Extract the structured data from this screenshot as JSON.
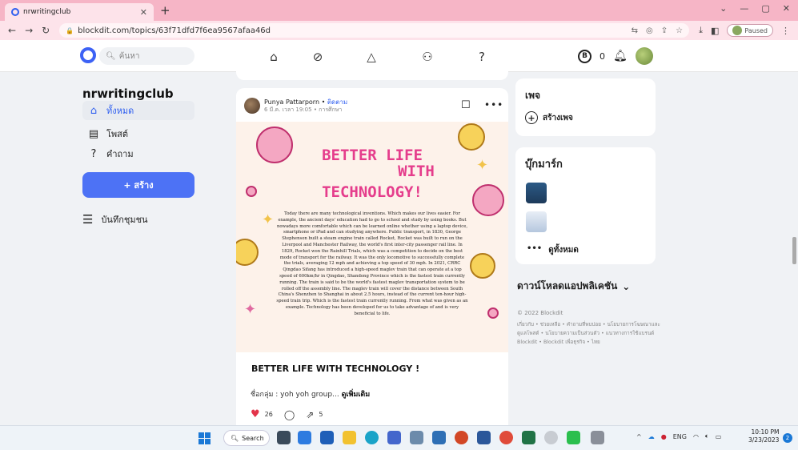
{
  "browser": {
    "tab_title": "nrwritingclub",
    "url": "blockdit.com/topics/63f71dfd7f6ea9567afaa46d",
    "paused_label": "Paused"
  },
  "header": {
    "search_placeholder": "ค้นหา",
    "coin_count": "0"
  },
  "sidebar": {
    "club_name": "nrwritingclub",
    "items": [
      {
        "label": "ทั้งหมด"
      },
      {
        "label": "โพสต์"
      },
      {
        "label": "คำถาม"
      }
    ],
    "create_label": "+ สร้าง",
    "notes_label": "บันทึกชุมชน"
  },
  "post": {
    "author": "Punya Pattarporn",
    "follow_label": "ติดตาม",
    "meta": "6 มี.ค. เวลา 19:05 • การศึกษา",
    "image_title_lines": [
      "BETTER LIFE",
      "WITH",
      "TECHNOLOGY!"
    ],
    "image_body": "Today there are many technological inventions. Which makes our lives easier. For example, the ancient days' education had to go to school and study by using books. But nowadays more comfortable which can be learned online whether using a laptop device, smartphone or iPad and can studying anywhere. Public transport, in 1830, George Stephenson built a steam engine train called Rocket, Rocket was built to run on the Liverpool and Manchester Railway, the world's first inter-city passenger rail line. In 1829, Rocket won the Rainhill Trials, which was a competition to decide on the best mode of transport for the railway. It was the only locomotive to successfully complete the trials, averaging 12 mph and achieving a top speed of 30 mph. In 2021, CRRC Qingdao Sifang has introduced a high-speed maglev train that can operate at a top speed of 600km/hr in Qingdao, Shandong Province which is the fastest train currently running. The train is said to be the world's fastest maglev transportation system to be rolled off the assembly line. The maglev train will cover the distance between South China's Shenzhen to Shanghai in about 2.5 hours, instead of the current ten-hour high-speed train trip. Which is the fastest train currently running. From what was given as an example. Technology has been developed for us to take advantage of and is very beneficial to life.",
    "title": "BETTER LIFE WITH TECHNOLOGY !",
    "group_prefix": "ชื่อกลุ่ม : yoh yoh group...",
    "see_more": "ดูเพิ่มเติม",
    "likes": "26",
    "shares": "5"
  },
  "right": {
    "page_title": "เพจ",
    "create_page": "สร้างเพจ",
    "bookmark_title": "บุ๊กมาร์ก",
    "see_all": "ดูทั้งหมด",
    "download_app": "ดาวน์โหลดแอปพลิเคชัน",
    "copyright": "© 2022 Blockdit",
    "footer_links": "เกี่ยวกับ • ช่วยเหลือ • คำถามที่พบบ่อย • นโยบายการโฆษณาและดูแลโพสต์ • นโยบายความเป็นส่วนตัว • แนวทางการใช้แบรนด์ Blockdit • Blockdit เพื่อธุรกิจ • ไทย"
  },
  "taskbar": {
    "search_label": "Search",
    "lang": "ENG",
    "time": "10:10 PM",
    "date": "3/23/2023",
    "badge": "2"
  },
  "colors": {
    "accent": "#4d72f5",
    "tabbar": "#f6b5c6",
    "title_pink": "#e53d8c"
  }
}
